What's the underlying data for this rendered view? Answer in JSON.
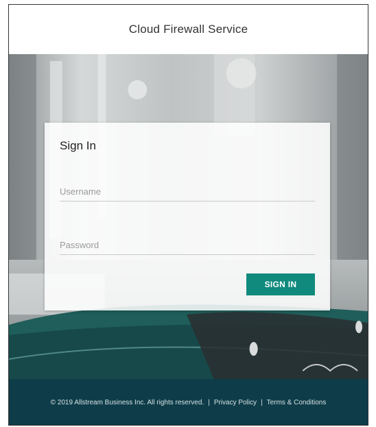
{
  "header": {
    "title": "Cloud Firewall Service"
  },
  "login": {
    "title": "Sign In",
    "username_placeholder": "Username",
    "password_placeholder": "Password",
    "submit_label": "SIGN IN"
  },
  "footer": {
    "copyright": "© 2019 Allstream Business Inc. All rights reserved.",
    "separator": "|",
    "privacy": "Privacy Policy",
    "terms": "Terms & Conditions"
  },
  "colors": {
    "accent": "#0f8a7c",
    "footer_bg": "#0e3d49",
    "header_bg": "#ffffff"
  }
}
